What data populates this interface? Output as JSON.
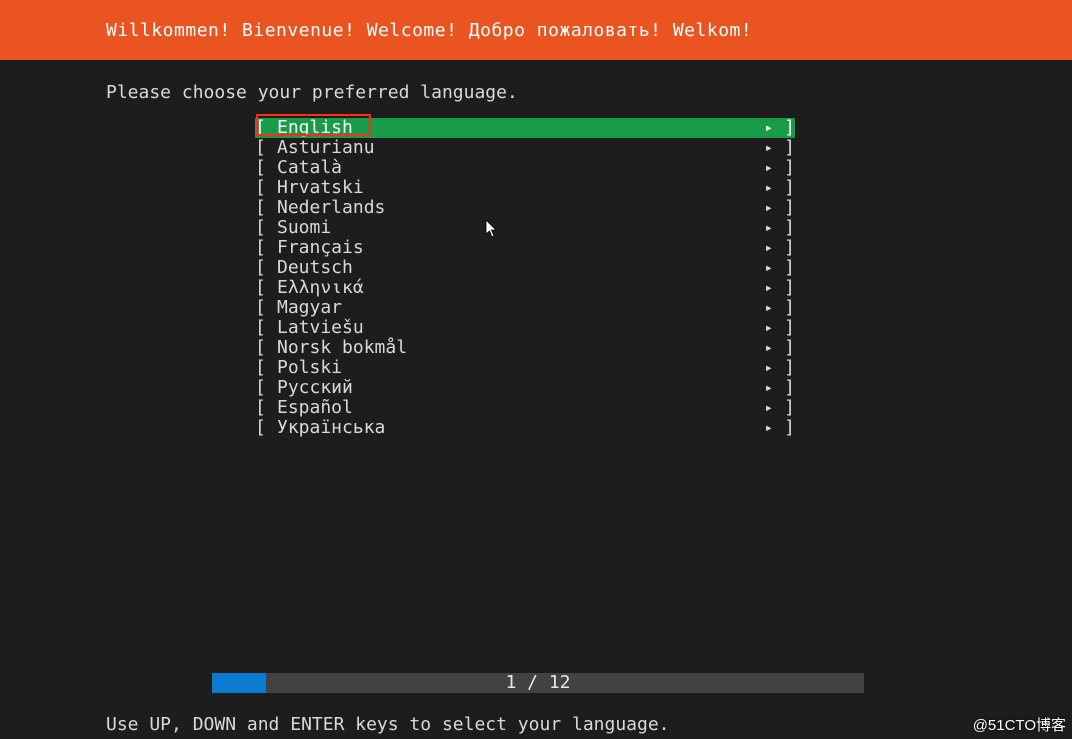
{
  "header": {
    "title": "Willkommen! Bienvenue! Welcome! Добро пожаловать! Welkom!"
  },
  "prompt": "Please choose your preferred language.",
  "languages": [
    {
      "name": "English",
      "selected": true
    },
    {
      "name": "Asturianu",
      "selected": false
    },
    {
      "name": "Català",
      "selected": false
    },
    {
      "name": "Hrvatski",
      "selected": false
    },
    {
      "name": "Nederlands",
      "selected": false
    },
    {
      "name": "Suomi",
      "selected": false
    },
    {
      "name": "Français",
      "selected": false
    },
    {
      "name": "Deutsch",
      "selected": false
    },
    {
      "name": "Ελληνικά",
      "selected": false
    },
    {
      "name": "Magyar",
      "selected": false
    },
    {
      "name": "Latviešu",
      "selected": false
    },
    {
      "name": "Norsk bokmål",
      "selected": false
    },
    {
      "name": "Polski",
      "selected": false
    },
    {
      "name": "Русский",
      "selected": false
    },
    {
      "name": "Español",
      "selected": false
    },
    {
      "name": "Українська",
      "selected": false
    }
  ],
  "bracket_left": "[",
  "bracket_right": "]",
  "arrow_glyph": "▸",
  "progress": {
    "current": 1,
    "total": 12,
    "label": "1 / 12"
  },
  "hint": "Use UP, DOWN and ENTER keys to select your language.",
  "watermark": "@51CTO博客"
}
